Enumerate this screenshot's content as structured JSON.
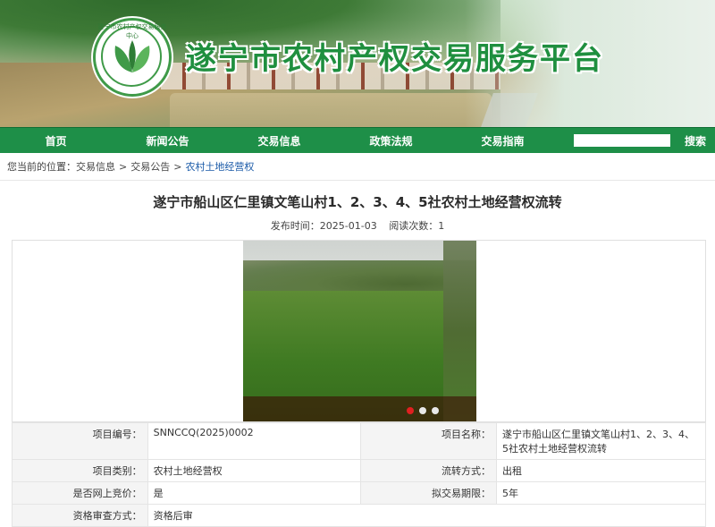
{
  "header": {
    "site_title": "遂宁市农村产权交易服务平台",
    "logo_ring_text": "遂宁市农村产权交易服务中心"
  },
  "nav": {
    "items": [
      "首页",
      "新闻公告",
      "交易信息",
      "政策法规",
      "交易指南"
    ],
    "search_placeholder": "",
    "search_label": "搜索"
  },
  "breadcrumb": {
    "prefix": "您当前的位置：",
    "items": [
      "交易信息",
      "交易公告",
      "农村土地经营权"
    ],
    "separator": ">"
  },
  "article": {
    "title": "遂宁市船山区仁里镇文笔山村1、2、3、4、5社农村土地经营权流转",
    "publish_label": "发布时间：",
    "publish_date": "2025-01-03",
    "views_label": "阅读次数：",
    "views": "1"
  },
  "carousel": {
    "dots": 3,
    "active_index": 0
  },
  "info": {
    "rows": [
      [
        "项目编号：",
        "SNNCCQ(2025)0002",
        "项目名称：",
        "遂宁市船山区仁里镇文笔山村1、2、3、4、5社农村土地经营权流转"
      ],
      [
        "项目类别：",
        "农村土地经营权",
        "流转方式：",
        "出租"
      ],
      [
        "是否网上竞价：",
        "是",
        "拟交易期限：",
        "5年"
      ],
      [
        "资格审查方式：",
        "资格后审",
        "",
        ""
      ]
    ]
  },
  "colors": {
    "brand_green": "#1e8f48",
    "title_green": "#1f8f3f",
    "link_blue": "#1a5aa8",
    "active_dot": "#e02020"
  }
}
